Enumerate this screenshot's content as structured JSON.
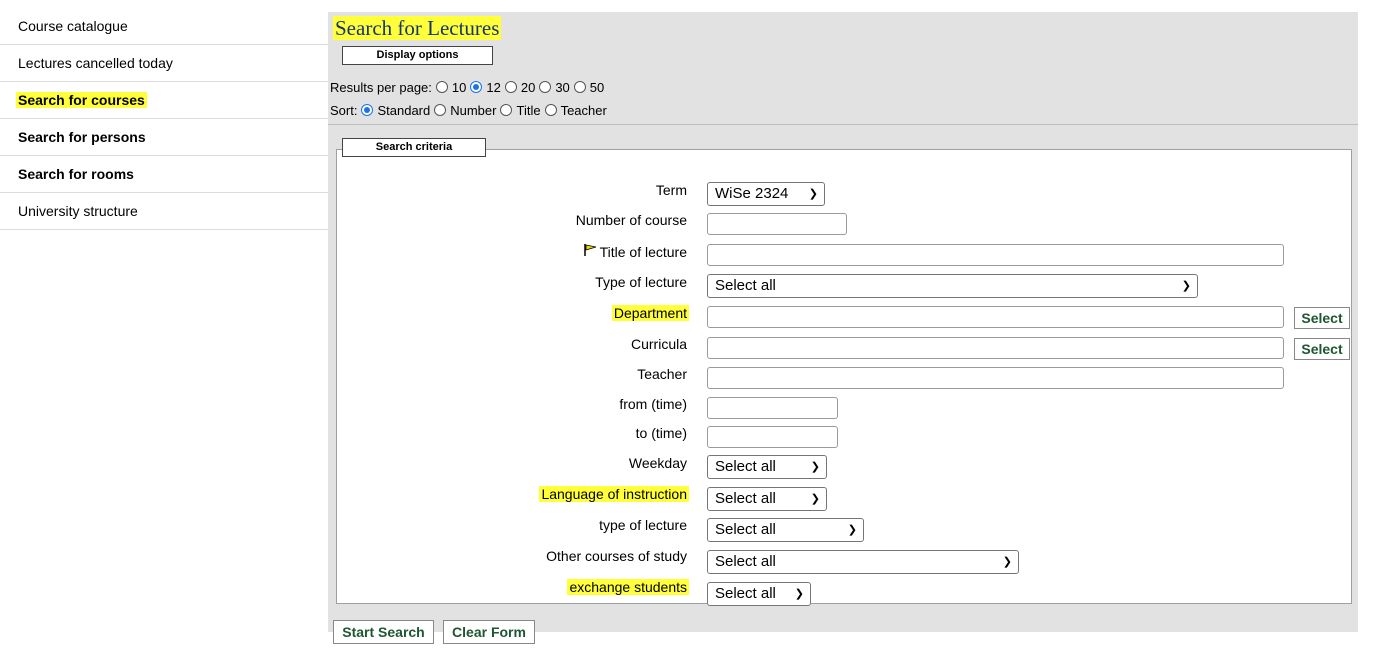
{
  "sidebar": {
    "items": [
      {
        "label": "Course catalogue"
      },
      {
        "label": "Lectures cancelled today"
      },
      {
        "label": "Search for courses"
      },
      {
        "label": "Search for persons"
      },
      {
        "label": "Search for rooms"
      },
      {
        "label": "University structure"
      }
    ]
  },
  "main": {
    "title": "Search for Lectures",
    "display_options": {
      "legend": "Display options",
      "results_label": "Results per page:",
      "results_options": [
        "10",
        "12",
        "20",
        "30",
        "50"
      ],
      "results_selected": "12",
      "sort_label": "Sort:",
      "sort_options": [
        "Standard",
        "Number",
        "Title",
        "Teacher"
      ],
      "sort_selected": "Standard"
    },
    "criteria": {
      "legend": "Search criteria",
      "fields": {
        "term": {
          "label": "Term",
          "value": "WiSe 2324"
        },
        "course_number": {
          "label": "Number of course",
          "value": ""
        },
        "title": {
          "label": "Title of lecture",
          "value": ""
        },
        "lecture_type": {
          "label": "Type of lecture",
          "value": "Select all"
        },
        "department": {
          "label": "Department",
          "value": "",
          "button": "Select"
        },
        "curricula": {
          "label": "Curricula",
          "value": "",
          "button": "Select"
        },
        "teacher": {
          "label": "Teacher",
          "value": ""
        },
        "from_time": {
          "label": "from (time)",
          "value": ""
        },
        "to_time": {
          "label": "to (time)",
          "value": ""
        },
        "weekday": {
          "label": "Weekday",
          "value": "Select all"
        },
        "language": {
          "label": "Language of instruction",
          "value": "Select all"
        },
        "type_lecture2": {
          "label": "type of lecture",
          "value": "Select all"
        },
        "other_courses": {
          "label": "Other courses of study",
          "value": "Select all"
        },
        "exchange": {
          "label": "exchange students",
          "value": "Select all"
        }
      }
    },
    "buttons": {
      "start": "Start Search",
      "clear": "Clear Form"
    }
  },
  "colors": {
    "highlight": "#ffff3a",
    "title": "#14366f",
    "button_text": "#1e5631",
    "radio": "#1a73e8"
  }
}
